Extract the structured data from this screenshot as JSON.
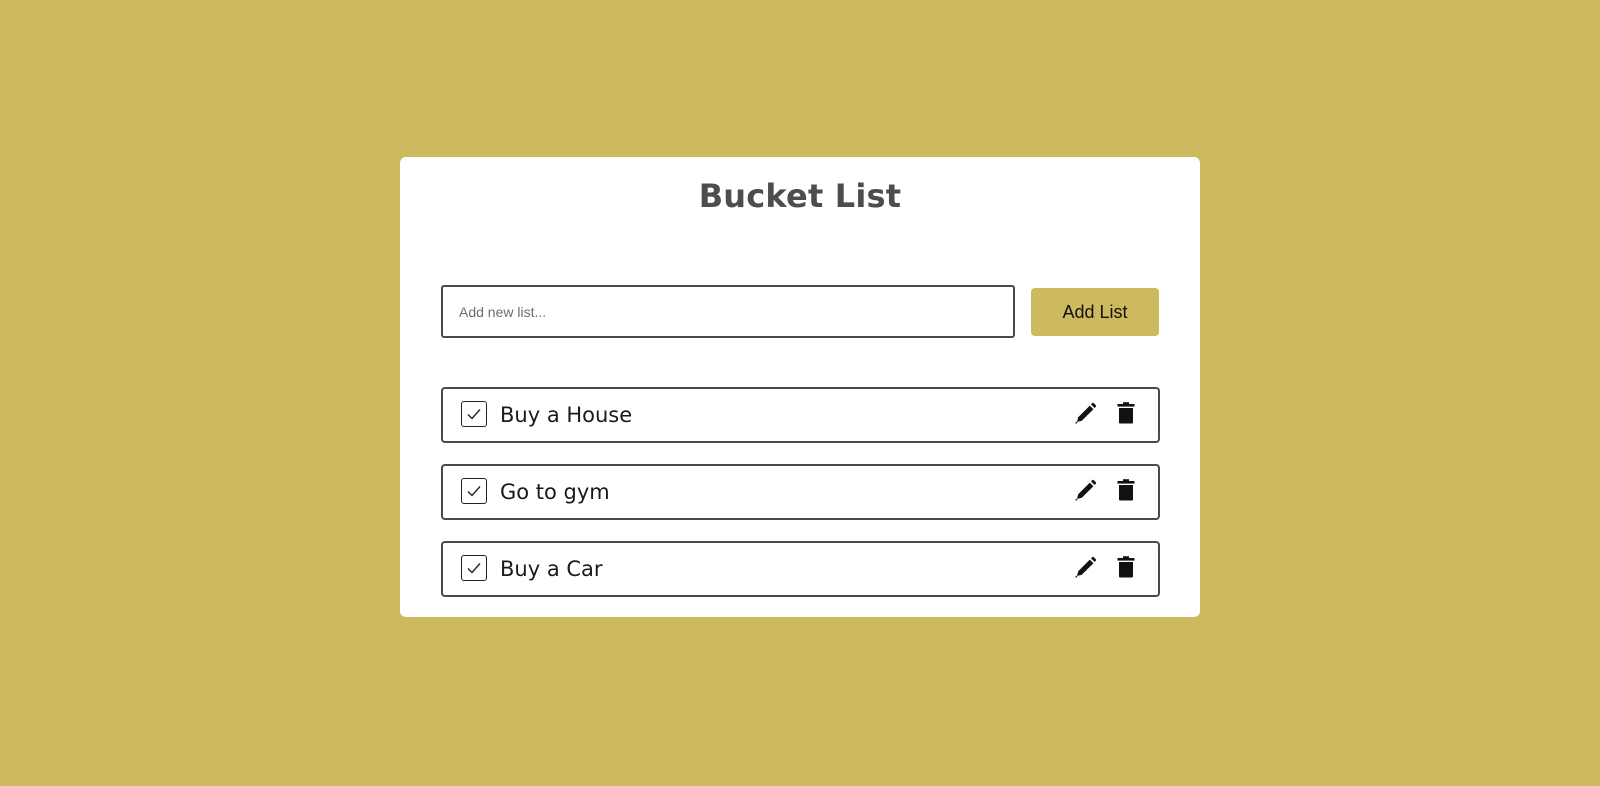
{
  "app": {
    "title": "Bucket List",
    "background_color": "#cdb95e",
    "accent_color": "#cdb95e"
  },
  "add_form": {
    "placeholder": "Add new list...",
    "value": "",
    "button_label": "Add List"
  },
  "items": [
    {
      "label": "Buy a House",
      "checked": true,
      "icons": [
        "checkbox-icon",
        "pencil-icon",
        "trash-icon"
      ]
    },
    {
      "label": "Go to gym",
      "checked": true,
      "icons": [
        "checkbox-icon",
        "pencil-icon",
        "trash-icon"
      ]
    },
    {
      "label": "Buy a Car",
      "checked": true,
      "icons": [
        "checkbox-icon",
        "pencil-icon",
        "trash-icon"
      ]
    }
  ]
}
